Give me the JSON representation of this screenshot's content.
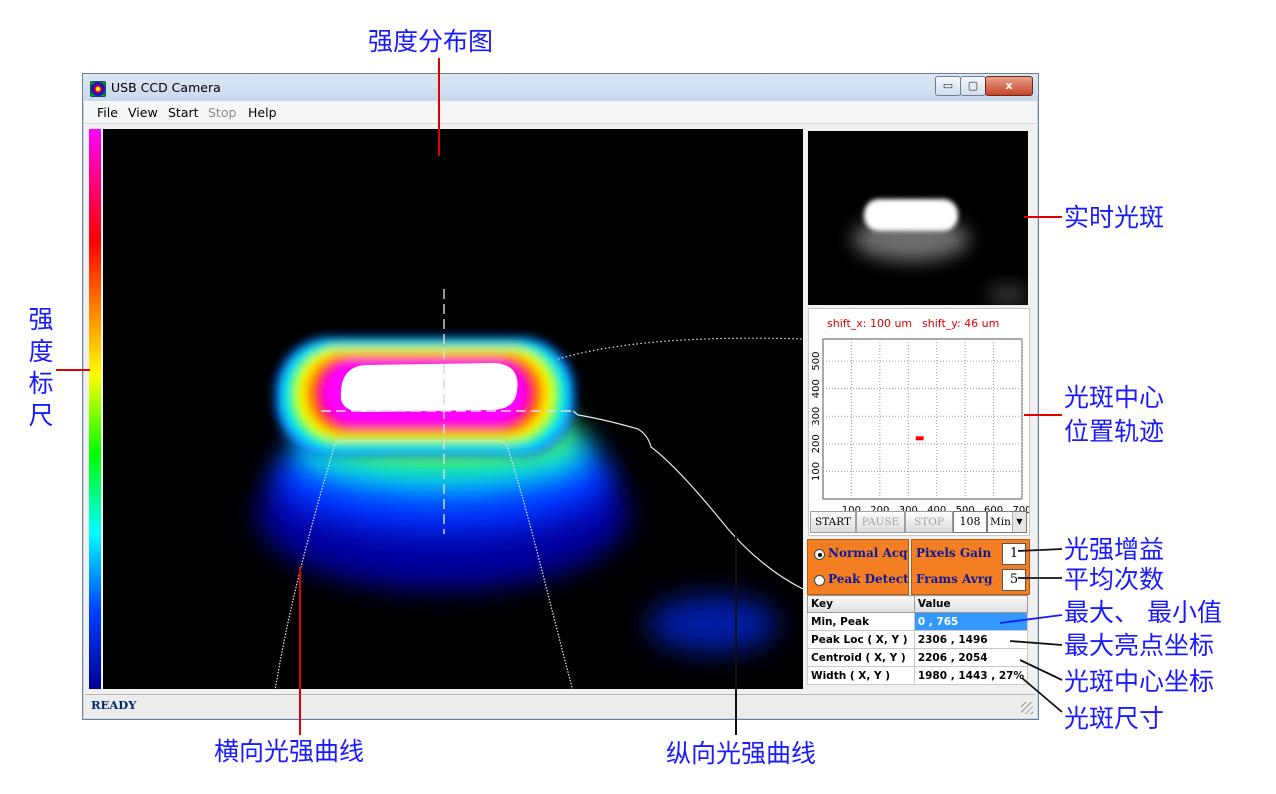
{
  "annotations": {
    "intensity_map": "强度分布图",
    "scale_chars": [
      "强",
      "度",
      "标",
      "尺"
    ],
    "live_spot": "实时光斑",
    "trajectory_line1": "光斑中心",
    "trajectory_line2": "位置轨迹",
    "gain": "光强增益",
    "average": "平均次数",
    "min_max": "最大、 最小值",
    "peak_coords": "最大亮点坐标",
    "centroid_coords": "光斑中心坐标",
    "spot_size": "光斑尺寸",
    "horizontal_curve": "横向光强曲线",
    "vertical_curve": "纵向光强曲线"
  },
  "window": {
    "title": "USB CCD Camera",
    "controls": {
      "minimize": "▭",
      "maximize": "▢",
      "close": "x"
    }
  },
  "menu": [
    "File",
    "View",
    "Start",
    "Stop",
    "Help"
  ],
  "status": "READY",
  "trajectory": {
    "shift_x": "shift_x: 100 um",
    "shift_y": "shift_y: 46 um",
    "x_ticks": [
      100,
      200,
      300,
      400,
      500,
      600,
      700
    ],
    "y_ticks": [
      100,
      200,
      300,
      400,
      500
    ],
    "point": {
      "x": 340,
      "y": 220
    },
    "xlim": [
      0,
      700
    ],
    "ylim": [
      0,
      580
    ],
    "point_color": "#ff0000"
  },
  "buttons": {
    "start": "START",
    "pause": "PAUSE",
    "stop": "STOP"
  },
  "frames_value": "108",
  "mode_select": "Min",
  "acquisition": {
    "normal": "Normal Acq",
    "peak": "Peak Detect"
  },
  "gain": {
    "pixels_gain_label": "Pixels Gain",
    "pixels_gain_value": "1",
    "frames_avg_label": "Frams Avrg",
    "frames_avg_value": "5"
  },
  "table": {
    "headers": [
      "Key",
      "Value"
    ],
    "rows": [
      [
        "Min, Peak",
        "0 , 765"
      ],
      [
        "Peak Loc ( X, Y )",
        "2306 , 1496"
      ],
      [
        "Centroid ( X, Y )",
        "2206 , 2054"
      ],
      [
        "Width ( X, Y )",
        "1980 , 1443 , 27%"
      ]
    ]
  },
  "colors": {
    "accent_orange": "#f47f22",
    "annotation_blue": "#1a1aff",
    "leader_red": "#e00000",
    "selection_blue": "#3399ff"
  }
}
